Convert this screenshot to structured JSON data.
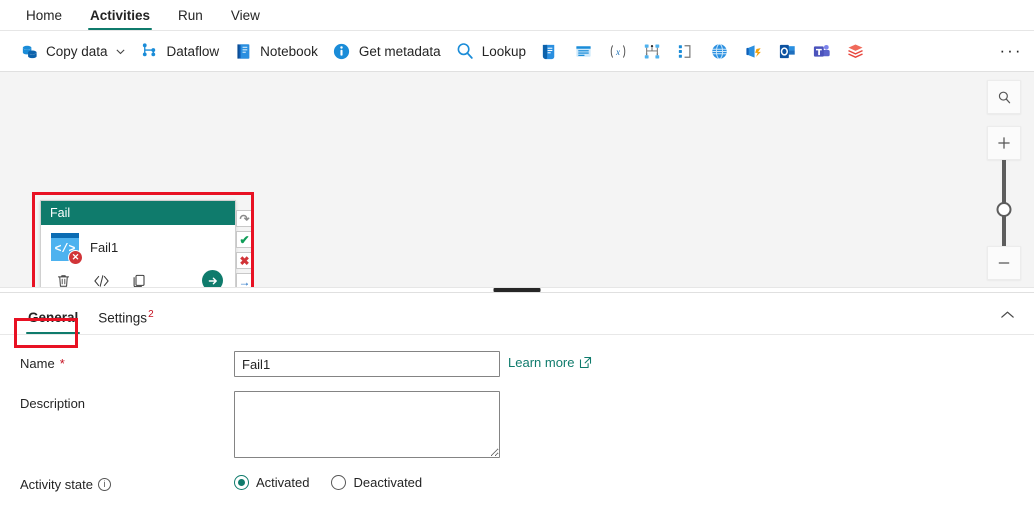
{
  "ribbon": {
    "tabs": [
      {
        "label": "Home",
        "active": false
      },
      {
        "label": "Activities",
        "active": true
      },
      {
        "label": "Run",
        "active": false
      },
      {
        "label": "View",
        "active": false
      }
    ]
  },
  "toolbar": {
    "items": [
      {
        "label": "Copy data",
        "icon": "copy-data-icon",
        "has_chevron": true
      },
      {
        "label": "Dataflow",
        "icon": "dataflow-icon",
        "has_chevron": false
      },
      {
        "label": "Notebook",
        "icon": "notebook-icon",
        "has_chevron": false
      },
      {
        "label": "Get metadata",
        "icon": "get-metadata-icon",
        "has_chevron": false
      },
      {
        "label": "Lookup",
        "icon": "lookup-icon",
        "has_chevron": false
      },
      {
        "label": "",
        "icon": "script-icon",
        "has_chevron": false
      },
      {
        "label": "",
        "icon": "stored-procedure-icon",
        "has_chevron": false
      },
      {
        "label": "",
        "icon": "set-variable-icon",
        "has_chevron": false
      },
      {
        "label": "",
        "icon": "switch-icon",
        "has_chevron": false
      },
      {
        "label": "",
        "icon": "if-condition-icon",
        "has_chevron": false
      },
      {
        "label": "",
        "icon": "web-icon",
        "has_chevron": false
      },
      {
        "label": "",
        "icon": "webhook-icon",
        "has_chevron": false
      },
      {
        "label": "",
        "icon": "outlook-icon",
        "has_chevron": false
      },
      {
        "label": "",
        "icon": "teams-icon",
        "has_chevron": false
      },
      {
        "label": "",
        "icon": "databricks-icon",
        "has_chevron": false
      }
    ],
    "overflow_label": "···"
  },
  "canvas": {
    "node": {
      "header_title": "Fail",
      "name": "Fail1",
      "icon": "fail-activity-icon",
      "glyph": "</>",
      "badge": "✕",
      "actions": [
        {
          "name": "delete-activity-button",
          "glyph": "🗑"
        },
        {
          "name": "view-code-button",
          "glyph": "</>"
        },
        {
          "name": "clone-activity-button",
          "glyph": "⧉"
        }
      ],
      "run_button_label": "→"
    },
    "handles": [
      {
        "name": "handle-on-skip",
        "glyph": "↷",
        "color": "#8a8a8a"
      },
      {
        "name": "handle-on-success",
        "glyph": "✔",
        "color": "#0f9d58"
      },
      {
        "name": "handle-on-failure",
        "glyph": "✖",
        "color": "#d13438"
      },
      {
        "name": "handle-on-completion",
        "glyph": "→",
        "color": "#1668c1"
      }
    ],
    "zoom_controls": {
      "fit_label": "⌕",
      "zoom_in_label": "+",
      "zoom_out_label": "−"
    }
  },
  "properties": {
    "tabs": [
      {
        "label": "General",
        "badge": "",
        "active": true
      },
      {
        "label": "Settings",
        "badge": "2",
        "active": false
      }
    ],
    "collapse_label": "⌃",
    "fields": {
      "name_label": "Name",
      "name_required": "*",
      "name_value": "Fail1",
      "name_placeholder": "",
      "learn_more_label": "Learn more",
      "description_label": "Description",
      "description_value": "",
      "description_placeholder": "",
      "activity_state_label": "Activity state",
      "activity_state_info": "ⓘ",
      "activity_state_options": [
        {
          "label": "Activated",
          "selected": true
        },
        {
          "label": "Deactivated",
          "selected": false
        }
      ]
    }
  },
  "annotations": {
    "accent_color": "#e81123",
    "brand_green": "#0f7b6c"
  }
}
